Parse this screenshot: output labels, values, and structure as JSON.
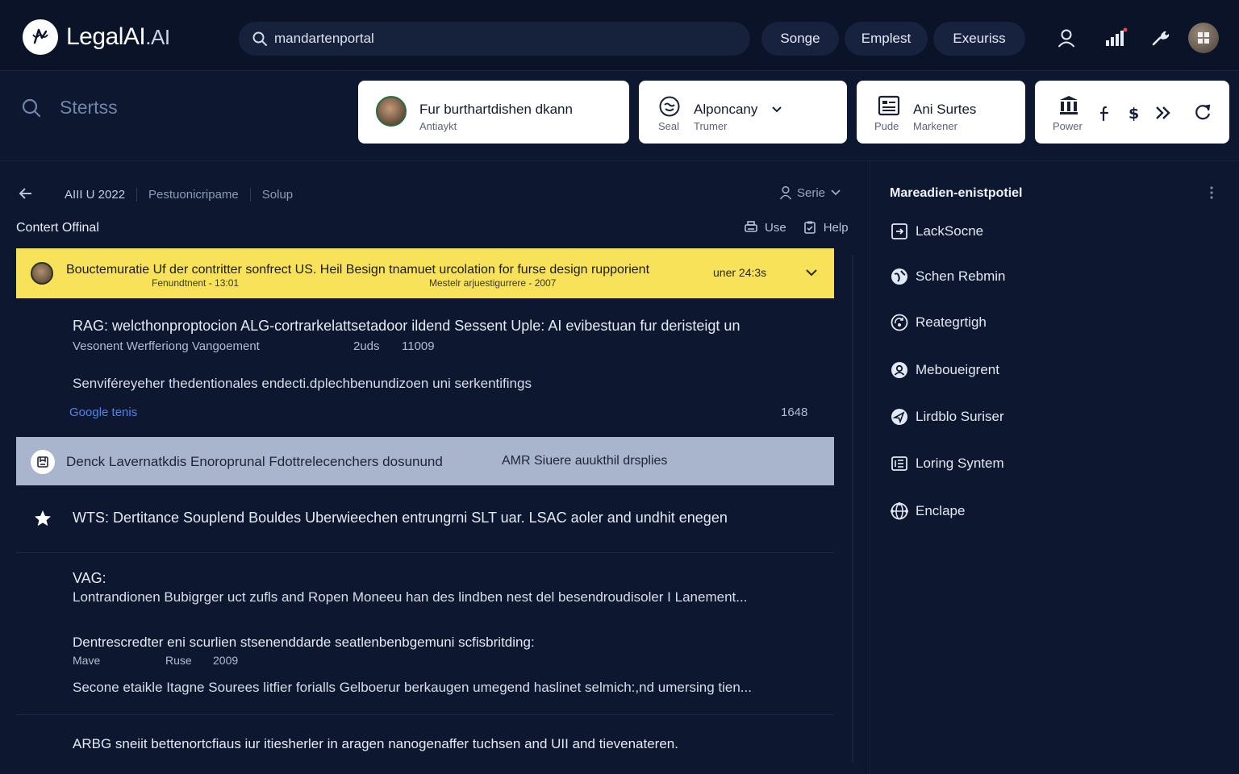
{
  "header": {
    "logo_text": "LegalAI",
    "logo_suffix": ".AI",
    "search_value": "mandartenportal",
    "nav": [
      "Songe",
      "Emplest",
      "Exeuriss"
    ]
  },
  "toolbar": {
    "status_label": "Stertss",
    "cards": [
      {
        "title": "Fur burthartdishen dkann",
        "sub": "Antiaykt"
      },
      {
        "title": "Alponcany",
        "sub1": "Seal",
        "sub2": "Trumer"
      },
      {
        "title": "Ani Surtes",
        "sub1": "Pude",
        "sub2": "Markener"
      },
      {
        "sub": "Power"
      }
    ]
  },
  "breadcrumb": [
    "AIII U 2022",
    "Pestuonicripame",
    "Solup"
  ],
  "serie_label": "Serie",
  "section": {
    "title": "Contert Offinal",
    "use_label": "Use",
    "help_label": "Help"
  },
  "highlight": {
    "title": "Bouctemuratie Uf der contritter sonfrect US. Heil Besign tnamuet urcolation for furse design rupporient",
    "meta_left": "Fenundtnent  -   13:01",
    "meta_right": "Mestelr arjuestigurrere  -   2007",
    "time": "uner 24:3s"
  },
  "item1": {
    "title": "RAG: welcthonproptocion ALG-cortrarkelattsetadoor ildend Sessent Uple: AI evibestuan fur deristeigt un",
    "sub_a": "Vesonent Werfferiong Vangoement",
    "sub_b": "2uds",
    "sub_c": "11009",
    "line2": "Senviféreyeher thedentionales endecti.dplechbenundizoen uni serkentifings",
    "link": "Google tenis",
    "count": "1648"
  },
  "selected": {
    "title": "Denck Lavernatkdis Enoroprunal Fdottrelecenchers dosunund",
    "extra": "AMR Siuere auukthil drsplies"
  },
  "starred": {
    "title": "WTS: Dertitance Souplend Bouldes Uberwieechen entrungrni SLT uar. LSAC aoler and undhit enegen"
  },
  "item3": {
    "label": "VAG:",
    "line": "Lontrandionen Bubigrger uct zufls and Ropen Moneeu han des lindben nest del besendroudisoler I Lanement..."
  },
  "item4": {
    "title": "Dentrescredter eni scurlien stsenenddarde seatlenbenbgemuni scfisbritding:",
    "meta_a": "Mave",
    "meta_b": "Ruse",
    "meta_c": "2009",
    "line": "Secone etaikle Itagne Sourees litfier forialls Gelboerur berkaugen umegend haslinet selmich:,nd umersing tien..."
  },
  "item5": {
    "title": "ARBG sneiit bettenortcfiaus iur itiesherler in aragen nanogenaffer tuchsen and UII and tievenateren."
  },
  "panel": {
    "title": "Mareadien-enistpotiel",
    "items": [
      "LackSocne",
      "Schen Rebmin",
      "Reategrtigh",
      "Meboueigrent",
      "Lirdblo Suriser",
      "Loring Syntem",
      "Enclape"
    ]
  }
}
